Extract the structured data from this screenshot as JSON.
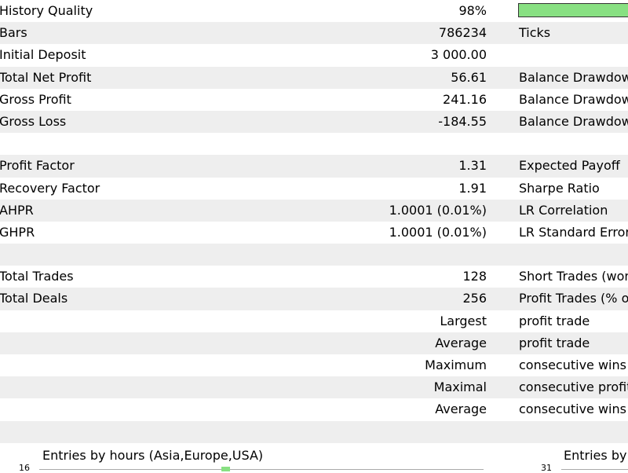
{
  "rows": [
    {
      "label": "History Quality",
      "value": "98%",
      "right": ""
    },
    {
      "label": "Bars",
      "value": "786234",
      "right": "Ticks"
    },
    {
      "label": "Initial Deposit",
      "value": "3 000.00",
      "right": ""
    },
    {
      "label": "Total Net Profit",
      "value": "56.61",
      "right": "Balance Drawdow"
    },
    {
      "label": "Gross Profit",
      "value": "241.16",
      "right": "Balance Drawdow"
    },
    {
      "label": "Gross Loss",
      "value": "-184.55",
      "right": "Balance Drawdow"
    },
    {
      "label": "",
      "value": "",
      "right": ""
    },
    {
      "label": "Profit Factor",
      "value": "1.31",
      "right": "Expected Payoff"
    },
    {
      "label": "Recovery Factor",
      "value": "1.91",
      "right": "Sharpe Ratio"
    },
    {
      "label": "AHPR",
      "value": "1.0001 (0.01%)",
      "right": "LR Correlation"
    },
    {
      "label": "GHPR",
      "value": "1.0001 (0.01%)",
      "right": "LR Standard Error"
    },
    {
      "label": "",
      "value": "",
      "right": ""
    },
    {
      "label": "Total Trades",
      "value": "128",
      "right": "Short Trades (won"
    },
    {
      "label": "Total Deals",
      "value": "256",
      "right": "Profit Trades (% of"
    },
    {
      "label": "",
      "value": "Largest",
      "right": "profit trade"
    },
    {
      "label": "",
      "value": "Average",
      "right": "profit trade"
    },
    {
      "label": "",
      "value": "Maximum",
      "right": "consecutive wins ("
    },
    {
      "label": "",
      "value": "Maximal",
      "right": "consecutive profit"
    },
    {
      "label": "",
      "value": "Average",
      "right": "consecutive wins"
    },
    {
      "label": "",
      "value": "",
      "right": ""
    }
  ],
  "history_quality_fraction": 0.98,
  "colors": {
    "shade": "#eeeeee",
    "quality_bar": "#88e082"
  },
  "charts": {
    "left_title": "Entries by hours (Asia,Europe,USA)",
    "left_axis_max": "16",
    "right_title": "Entries by",
    "right_axis_max": "31"
  }
}
